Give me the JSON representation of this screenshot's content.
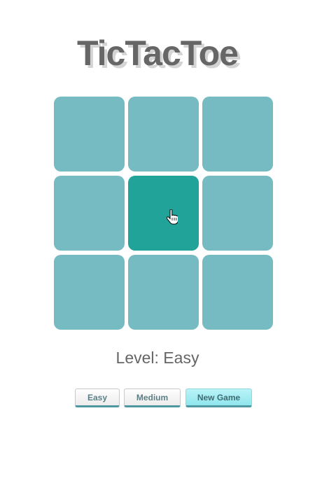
{
  "game": {
    "title": "TicTacToe",
    "level_text": "Level: Easy",
    "board": {
      "cells": [
        "",
        "",
        "",
        "",
        "",
        "",
        "",
        "",
        ""
      ],
      "hovered_cell": 4
    },
    "buttons": {
      "easy": "Easy",
      "medium": "Medium",
      "new_game": "New Game"
    },
    "colors": {
      "cell": "#76bbc2",
      "cell_hover": "#21a39a",
      "title": "#666666",
      "new_game_button": "#a6edf3"
    },
    "cursor_icon": "hand-pointer-icon"
  }
}
